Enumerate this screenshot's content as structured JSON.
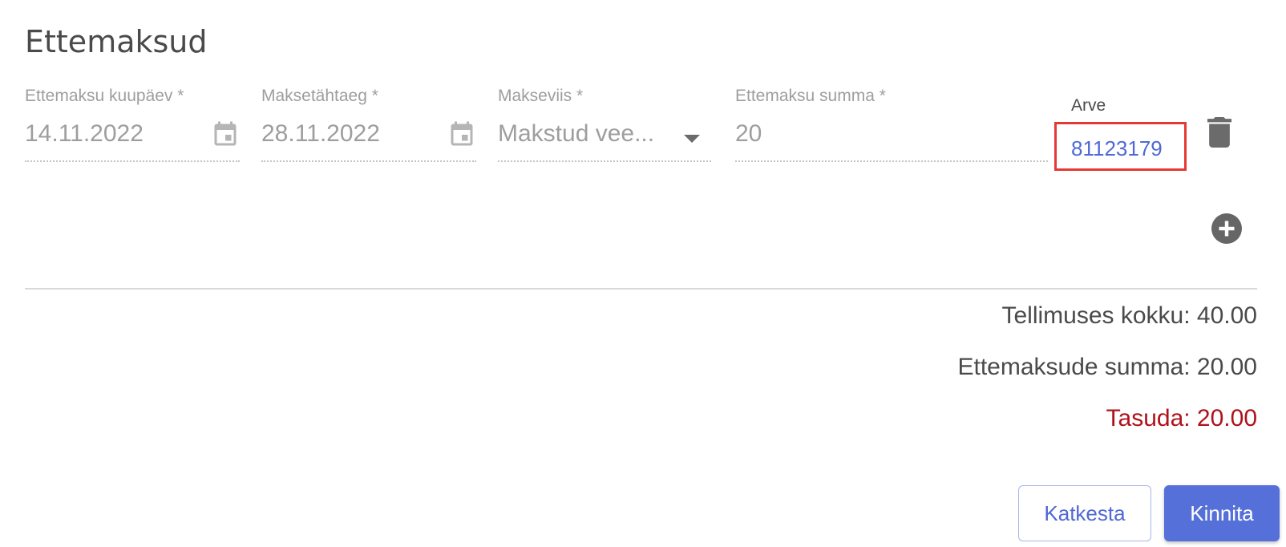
{
  "dialog": {
    "title": "Ettemaksud"
  },
  "prepayment_row": {
    "date": {
      "label": "Ettemaksu kuupäev *",
      "value": "14.11.2022",
      "icon": "calendar-icon"
    },
    "due_date": {
      "label": "Maksetähtaeg *",
      "value": "28.11.2022",
      "icon": "calendar-icon"
    },
    "payment_method": {
      "label": "Makseviis *",
      "value": "Makstud vee...",
      "icon": "chevron-down-icon"
    },
    "amount": {
      "label": "Ettemaksu summa *",
      "value": "20"
    },
    "invoice": {
      "label": "Arve",
      "value": "81123179",
      "highlight_color": "#e53935"
    },
    "delete_icon": "trash-icon"
  },
  "add_icon": "plus-circle-icon",
  "summary": {
    "order_total": "Tellimuses kokku: 40.00",
    "prepayments_total": "Ettemaksude summa: 20.00",
    "to_pay": "Tasuda: 20.00",
    "to_pay_color": "#b0121b"
  },
  "actions": {
    "cancel_label": "Katkesta",
    "confirm_label": "Kinnita",
    "accent_color": "#5570d9"
  }
}
